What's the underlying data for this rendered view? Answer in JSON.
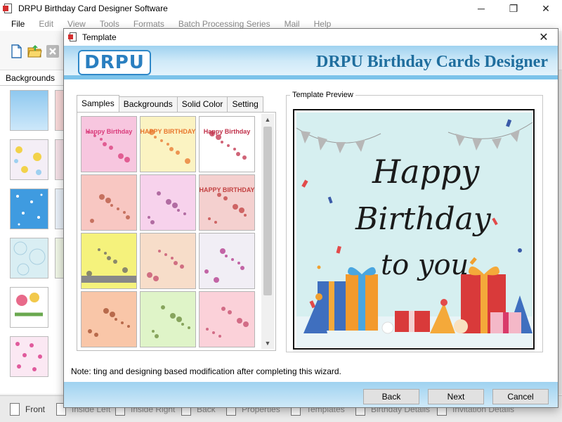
{
  "app": {
    "title": "DRPU Birthday Card Designer Software",
    "window_controls": {
      "minimize": "─",
      "maximize": "❐",
      "close": "✕"
    }
  },
  "menu": [
    {
      "label": "File",
      "dim": false
    },
    {
      "label": "Edit",
      "dim": true
    },
    {
      "label": "View",
      "dim": true
    },
    {
      "label": "Tools",
      "dim": true
    },
    {
      "label": "Formats",
      "dim": true
    },
    {
      "label": "Batch Processing Series",
      "dim": true
    },
    {
      "label": "Mail",
      "dim": true
    },
    {
      "label": "Help",
      "dim": true
    }
  ],
  "left_panel": {
    "title": "Backgrounds"
  },
  "bottom_tabs": [
    {
      "label": "Front",
      "dim": false
    },
    {
      "label": "Inside Left",
      "dim": true
    },
    {
      "label": "Inside Right",
      "dim": true
    },
    {
      "label": "Back",
      "dim": true
    },
    {
      "label": "Properties",
      "dim": true
    },
    {
      "label": "Templates",
      "dim": true
    },
    {
      "label": "Birthday Details",
      "dim": true
    },
    {
      "label": "Invitation Details",
      "dim": true
    }
  ],
  "dialog": {
    "title": "Template",
    "close": "✕",
    "logo": "DRPU",
    "banner_title": "DRPU Birthday Cards Designer",
    "tabs": [
      "Samples",
      "Backgrounds",
      "Solid Color",
      "Setting"
    ],
    "active_tab": "Samples",
    "preview_label": "Template Preview",
    "note": "Note: ting and designing based modification after completing this wizard.",
    "buttons": {
      "back": "Back",
      "next": "Next",
      "cancel": "Cancel"
    },
    "scroll": {
      "up": "▲",
      "down": "▼"
    }
  },
  "samples": [
    {
      "bg": "#f7c6df",
      "label": "Happy Birthday",
      "accent": "#d93a7a"
    },
    {
      "bg": "#fbf3c2",
      "label": "HAPPY BIRTHDAY",
      "accent": "#e8762c"
    },
    {
      "bg": "#ffffff",
      "label": "Happy Birthday",
      "accent": "#c0304a"
    },
    {
      "bg": "#f8c7c2",
      "label": "",
      "accent": "#b5543e"
    },
    {
      "bg": "#f7d2ec",
      "label": "",
      "accent": "#9a4a8a"
    },
    {
      "bg": "#f4d0cf",
      "label": "HAPPY BIRTHDAY",
      "accent": "#c24040"
    },
    {
      "bg": "#f5f27c",
      "label": "",
      "accent": "#666666"
    },
    {
      "bg": "#f7ddc9",
      "label": "",
      "accent": "#c34a6a"
    },
    {
      "bg": "#f1eef5",
      "label": "",
      "accent": "#b2368a"
    },
    {
      "bg": "#f9c6a8",
      "label": "",
      "accent": "#a14b2c"
    },
    {
      "bg": "#dff4c8",
      "label": "",
      "accent": "#6a8a3a"
    },
    {
      "bg": "#fbd1d9",
      "label": "",
      "accent": "#c44a6a"
    }
  ],
  "preview": {
    "line1": "Happy",
    "line2": "Birthday",
    "line3": "to you",
    "background": "#d6eff0"
  }
}
